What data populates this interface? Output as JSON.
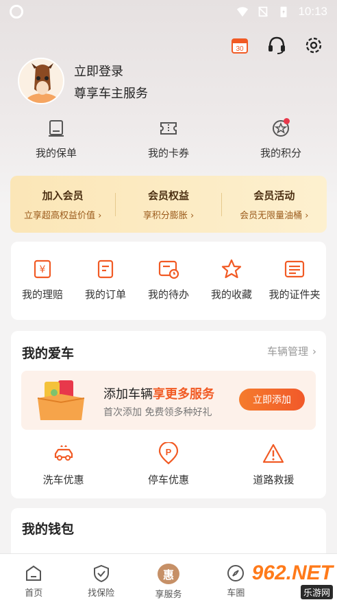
{
  "status_bar": {
    "time": "10:13"
  },
  "header": {
    "calendar_day": "30"
  },
  "profile": {
    "login_text": "立即登录",
    "subtitle": "尊享车主服务"
  },
  "quick": [
    {
      "label": "我的保单",
      "icon": "policy-icon"
    },
    {
      "label": "我的卡券",
      "icon": "coupon-icon"
    },
    {
      "label": "我的积分",
      "icon": "points-icon"
    }
  ],
  "member": [
    {
      "title": "加入会员",
      "sub": "立享超高权益价值"
    },
    {
      "title": "会员权益",
      "sub": "享积分膨胀"
    },
    {
      "title": "会员活动",
      "sub": "会员无限量油桶"
    }
  ],
  "services": [
    {
      "label": "我的理赔",
      "icon": "claim-icon"
    },
    {
      "label": "我的订单",
      "icon": "order-icon"
    },
    {
      "label": "我的待办",
      "icon": "todo-icon"
    },
    {
      "label": "我的收藏",
      "icon": "star-icon"
    },
    {
      "label": "我的证件夹",
      "icon": "document-folder-icon"
    }
  ],
  "car": {
    "title": "我的爱车",
    "manage": "车辆管理",
    "banner_title_prefix": "添加车辆",
    "banner_title_highlight": "享更多服务",
    "banner_sub": "首次添加 免费领多种好礼",
    "add_button": "立即添加",
    "services": [
      {
        "label": "洗车优惠",
        "icon": "car-wash-icon"
      },
      {
        "label": "停车优惠",
        "icon": "parking-icon"
      },
      {
        "label": "道路救援",
        "icon": "warning-icon"
      }
    ]
  },
  "wallet": {
    "title": "我的钱包",
    "dots": "···"
  },
  "tabs": [
    {
      "label": "首页",
      "icon": "home-icon"
    },
    {
      "label": "找保险",
      "icon": "shield-icon"
    },
    {
      "label": "享服务",
      "icon": "hui-icon",
      "glyph": "惠"
    },
    {
      "label": "车圈",
      "icon": "compass-icon"
    }
  ],
  "watermark": {
    "brand": "962.NET",
    "sub": "乐游网"
  },
  "colors": {
    "accent": "#f15a24",
    "gold": "#fbe6b7",
    "tab_center": "#c69067"
  }
}
